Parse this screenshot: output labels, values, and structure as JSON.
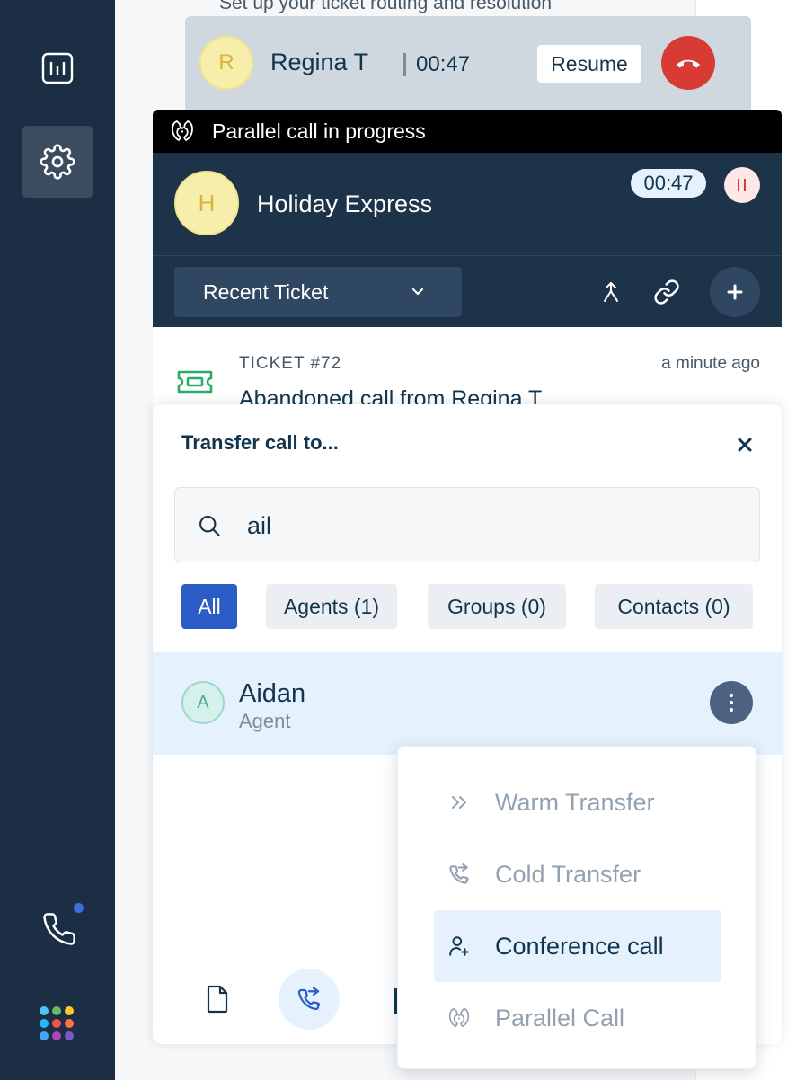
{
  "background": {
    "header_text": "Set up your ticket routing and resolution"
  },
  "held_call": {
    "avatar_initial": "R",
    "name": "Regina T",
    "timer": "00:47",
    "resume_label": "Resume"
  },
  "active_call": {
    "banner": "Parallel call in progress",
    "avatar_initial": "H",
    "name": "Holiday Express",
    "timer": "00:47",
    "ticket_select_label": "Recent Ticket"
  },
  "ticket": {
    "number": "TICKET #72",
    "time": "a minute ago",
    "title": "Abandoned call from Regina T"
  },
  "transfer": {
    "title": "Transfer call to...",
    "search_value": "ail",
    "filters": [
      {
        "label": "All",
        "active": true
      },
      {
        "label": "Agents (1)",
        "active": false
      },
      {
        "label": "Groups (0)",
        "active": false
      },
      {
        "label": "Contacts (0)",
        "active": false
      }
    ],
    "results": [
      {
        "initial": "A",
        "name": "Aidan",
        "role": "Agent"
      }
    ]
  },
  "menu": {
    "items": [
      {
        "label": "Warm Transfer",
        "icon": "double-chevron-right-icon",
        "highlight": false
      },
      {
        "label": "Cold Transfer",
        "icon": "phone-forward-icon",
        "highlight": false
      },
      {
        "label": "Conference call",
        "icon": "add-person-icon",
        "highlight": true
      },
      {
        "label": "Parallel Call",
        "icon": "parallel-call-icon",
        "highlight": false
      }
    ]
  },
  "colors": {
    "sidebar": "#1c2e44",
    "panel_dark": "#1c3349",
    "accent": "#2c5cc5",
    "hangup": "#d83a34",
    "highlight": "#e5f2fd",
    "avatar_yellow": "#f7eeab"
  }
}
